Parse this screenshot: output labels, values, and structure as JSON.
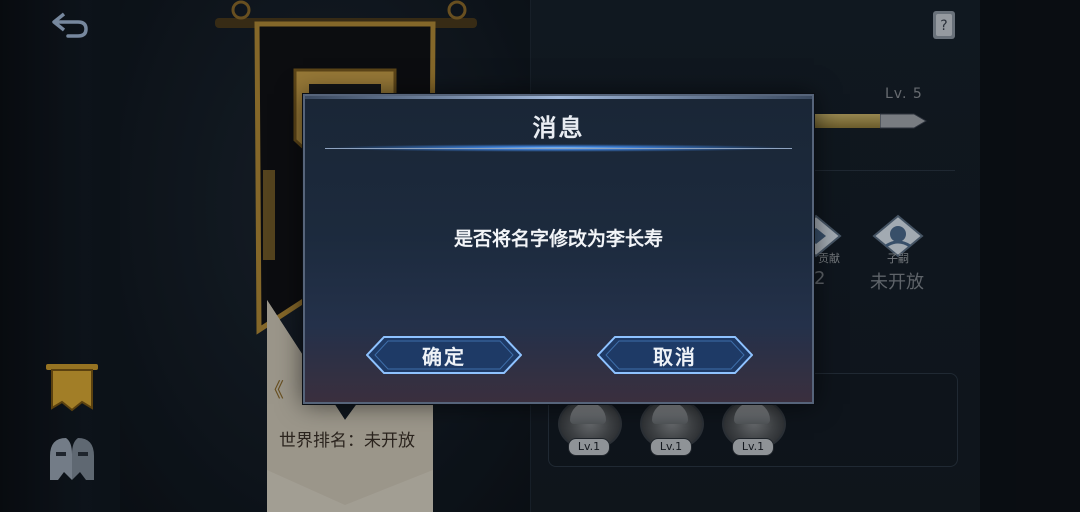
{
  "dialog": {
    "title": "消息",
    "message": "是否将名字修改为李长寿",
    "confirm_label": "确定",
    "cancel_label": "取消"
  },
  "banner": {
    "world_rank": "世界排名：未开放"
  },
  "player": {
    "level": "Lv. 5"
  },
  "features": [
    {
      "label": "贡献",
      "status": "2"
    },
    {
      "label": "子嗣",
      "status": "未开放"
    }
  ],
  "heroes": [
    {
      "level": "Lv.1"
    },
    {
      "level": "Lv.1"
    },
    {
      "level": "Lv.1"
    }
  ]
}
